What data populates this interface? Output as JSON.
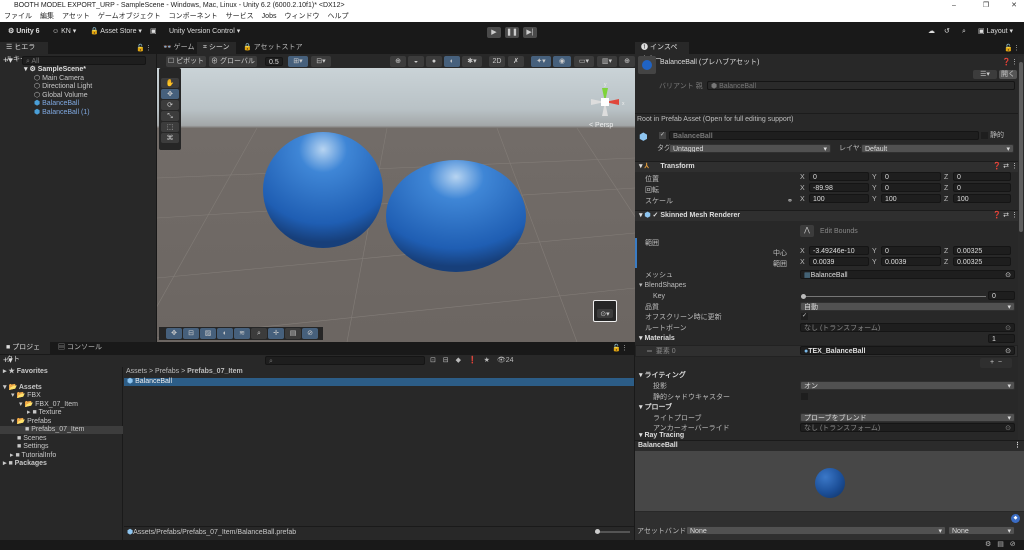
{
  "window": {
    "title": "BOOTH MODEL EXPORT_URP - SampleScene - Windows, Mac, Linux - Unity 6.2 (6000.2.10f1)* <DX12>",
    "minimize": "–",
    "maximize": "❐",
    "close": "✕"
  },
  "menu": [
    "ファイル",
    "編集",
    "アセット",
    "ゲームオブジェクト",
    "コンポーネント",
    "サービス",
    "Jobs",
    "ウィンドウ",
    "ヘルプ"
  ],
  "toolbar": {
    "unity": "Unity 6",
    "account": "KN",
    "asset_store": "Asset Store",
    "version_control": "Unity Version Control",
    "layout": "Layout"
  },
  "hierarchy": {
    "tab": "ヒエラルキー",
    "search_placeholder": "All",
    "scene": "SampleScene*",
    "items": [
      "Main Camera",
      "Directional Light",
      "Global Volume",
      "BalanceBall",
      "BalanceBall (1)"
    ]
  },
  "scene": {
    "tabs": [
      "ゲーム",
      "シーン",
      "アセットストア"
    ],
    "pivot": "ピボット",
    "global": "グローバル",
    "snap": "0.5",
    "persp": "< Persp",
    "axis_y": "y",
    "axis_x": "x"
  },
  "project": {
    "tabs": [
      "プロジェクト",
      "コンソール"
    ],
    "tree": [
      "Favorites",
      "Assets",
      "FBX",
      "FBX_07_Item",
      "Texture",
      "Prefabs",
      "Prefabs_07_Item",
      "Scenes",
      "Settings",
      "TutorialInfo",
      "Packages"
    ],
    "breadcrumb": [
      "Assets",
      "Prefabs",
      "Prefabs_07_Item"
    ],
    "files": [
      "BalanceBall"
    ],
    "path": "Assets/Prefabs/Prefabs_07_Item/BalanceBall.prefab",
    "count": "24"
  },
  "inspector": {
    "tab": "インスペクター",
    "title": "BalanceBall (プレハブアセット)",
    "open": "開く",
    "variant_label": "バリアント 親",
    "variant_value": "BalanceBall",
    "root_note": "Root in Prefab Asset (Open for full editing support)",
    "name": "BalanceBall",
    "static": "静的",
    "tag_label": "タグ",
    "tag": "Untagged",
    "layer_label": "レイヤー",
    "layer": "Default",
    "transform": {
      "title": "Transform",
      "position": "位置",
      "rotation": "回転",
      "scale": "スケール",
      "pos": [
        "0",
        "0",
        "0"
      ],
      "rot": [
        "-89.98",
        "0",
        "0"
      ],
      "scl": [
        "100",
        "100",
        "100"
      ]
    },
    "smr": {
      "title": "Skinned Mesh Renderer",
      "edit_bounds": "Edit Bounds",
      "bounds": "範囲",
      "center": "中心",
      "extent": "範囲",
      "center_v": [
        "-3.49246e-10",
        "0",
        "0.00325"
      ],
      "extent_v": [
        "0.0039",
        "0.0039",
        "0.00325"
      ],
      "mesh_label": "メッシュ",
      "mesh": "BalanceBall",
      "blendshapes": "BlendShapes",
      "key": "Key",
      "key_value": "0",
      "quality_label": "品質",
      "quality": "自動",
      "offscreen": "オフスクリーン時に更新",
      "rootbone_label": "ルートボーン",
      "rootbone": "なし (トランスフォーム)",
      "materials": "Materials",
      "materials_count": "1",
      "element0": "要素 0",
      "material": "TEX_BalanceBall",
      "lighting": "ライティング",
      "cast": "投影",
      "cast_value": "オン",
      "static_shadow": "静的シャドウキャスター",
      "probes": "プローブ",
      "light_probe": "ライトプローブ",
      "light_probe_value": "プローブをブレンド",
      "anchor": "アンカーオーバーライド",
      "anchor_value": "なし (トランスフォーム)",
      "raytracing": "Ray Tracing"
    },
    "preview_title": "BalanceBall",
    "assetbundle_label": "アセットバンドル",
    "assetbundle": "None",
    "variant": "None"
  },
  "axes": {
    "x": "X",
    "y": "Y",
    "z": "Z"
  }
}
